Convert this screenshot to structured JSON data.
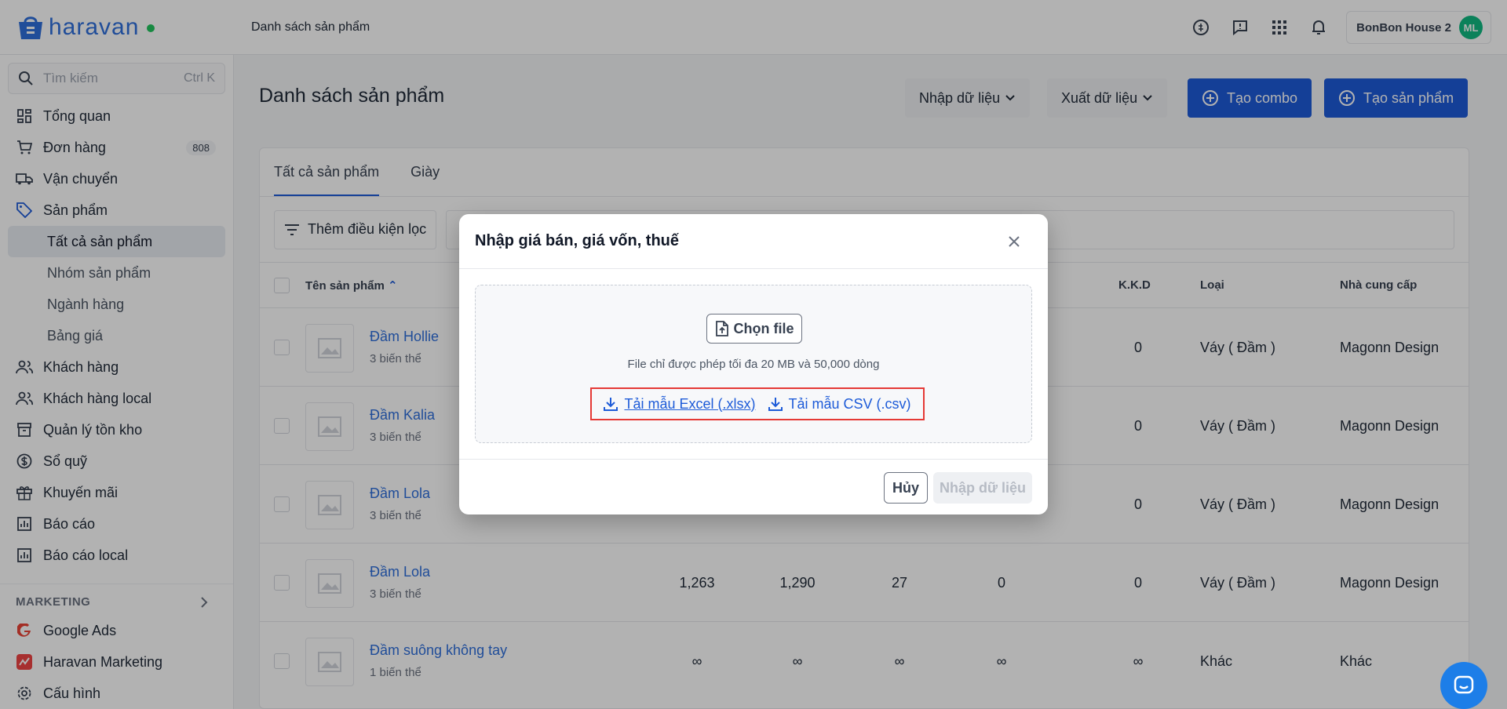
{
  "topbar": {
    "logo_text": "haravan",
    "page_title": "Danh sách sản phẩm",
    "store_name": "BonBon House 2",
    "avatar_initials": "ML"
  },
  "sidebar": {
    "search_placeholder": "Tìm kiếm",
    "search_shortcut": "Ctrl K",
    "items": [
      {
        "label": "Tổng quan"
      },
      {
        "label": "Đơn hàng",
        "badge": "808"
      },
      {
        "label": "Vận chuyển"
      },
      {
        "label": "Sản phẩm"
      }
    ],
    "product_sub": [
      "Tất cả sản phẩm",
      "Nhóm sản phẩm",
      "Ngành hàng",
      "Bảng giá"
    ],
    "items2": [
      {
        "label": "Khách hàng"
      },
      {
        "label": "Khách hàng local"
      },
      {
        "label": "Quản lý tồn kho"
      },
      {
        "label": "Sổ quỹ"
      },
      {
        "label": "Khuyến mãi"
      },
      {
        "label": "Báo cáo"
      },
      {
        "label": "Báo cáo local"
      }
    ],
    "marketing_label": "MARKETING",
    "marketing_items": [
      "Google Ads",
      "Haravan Marketing"
    ],
    "config_label": "Cấu hình"
  },
  "main": {
    "title": "Danh sách sản phẩm",
    "import_label": "Nhập dữ liệu",
    "export_label": "Xuất dữ liệu",
    "create_combo_label": "Tạo combo",
    "create_product_label": "Tạo sản phẩm",
    "tabs": [
      "Tất cả sản phẩm",
      "Giày"
    ],
    "filter_label": "Thêm điều kiện lọc",
    "columns": {
      "name": "Tên sản phẩm",
      "kkd": "K.K.D",
      "type": "Loại",
      "supplier": "Nhà cung cấp"
    },
    "rows": [
      {
        "name": "Đầm Hollie",
        "variants": "3 biến thể",
        "c1": "",
        "c2": "",
        "c3": "",
        "c4": "",
        "kkd": "0",
        "type": "Váy ( Đầm )",
        "supplier": "Magonn Design"
      },
      {
        "name": "Đầm Kalia",
        "variants": "3 biến thể",
        "c1": "",
        "c2": "",
        "c3": "",
        "c4": "",
        "kkd": "0",
        "type": "Váy ( Đầm )",
        "supplier": "Magonn Design"
      },
      {
        "name": "Đầm Lola",
        "variants": "3 biến thể",
        "c1": "",
        "c2": "",
        "c3": "",
        "c4": "",
        "kkd": "0",
        "type": "Váy ( Đầm )",
        "supplier": "Magonn Design"
      },
      {
        "name": "Đầm Lola",
        "variants": "3 biến thể",
        "c1": "1,263",
        "c2": "1,290",
        "c3": "27",
        "c4": "0",
        "kkd": "0",
        "type": "Váy ( Đầm )",
        "supplier": "Magonn Design"
      },
      {
        "name": "Đầm suông không tay",
        "variants": "1 biến thể",
        "c1": "∞",
        "c2": "∞",
        "c3": "∞",
        "c4": "∞",
        "kkd": "∞",
        "type": "Khác",
        "supplier": "Khác"
      }
    ]
  },
  "modal": {
    "title": "Nhập giá bán, giá vốn, thuế",
    "choose_file": "Chọn file",
    "note": "File chỉ được phép tối đa 20 MB và 50,000 dòng",
    "excel_link": "Tải mẫu Excel (.xlsx)",
    "csv_link": "Tải mẫu CSV (.csv)",
    "cancel": "Hủy",
    "submit": "Nhập dữ liệu"
  },
  "colors": {
    "accent": "#1d5bd8",
    "highlight": "#e53935",
    "online": "#22c55e"
  }
}
